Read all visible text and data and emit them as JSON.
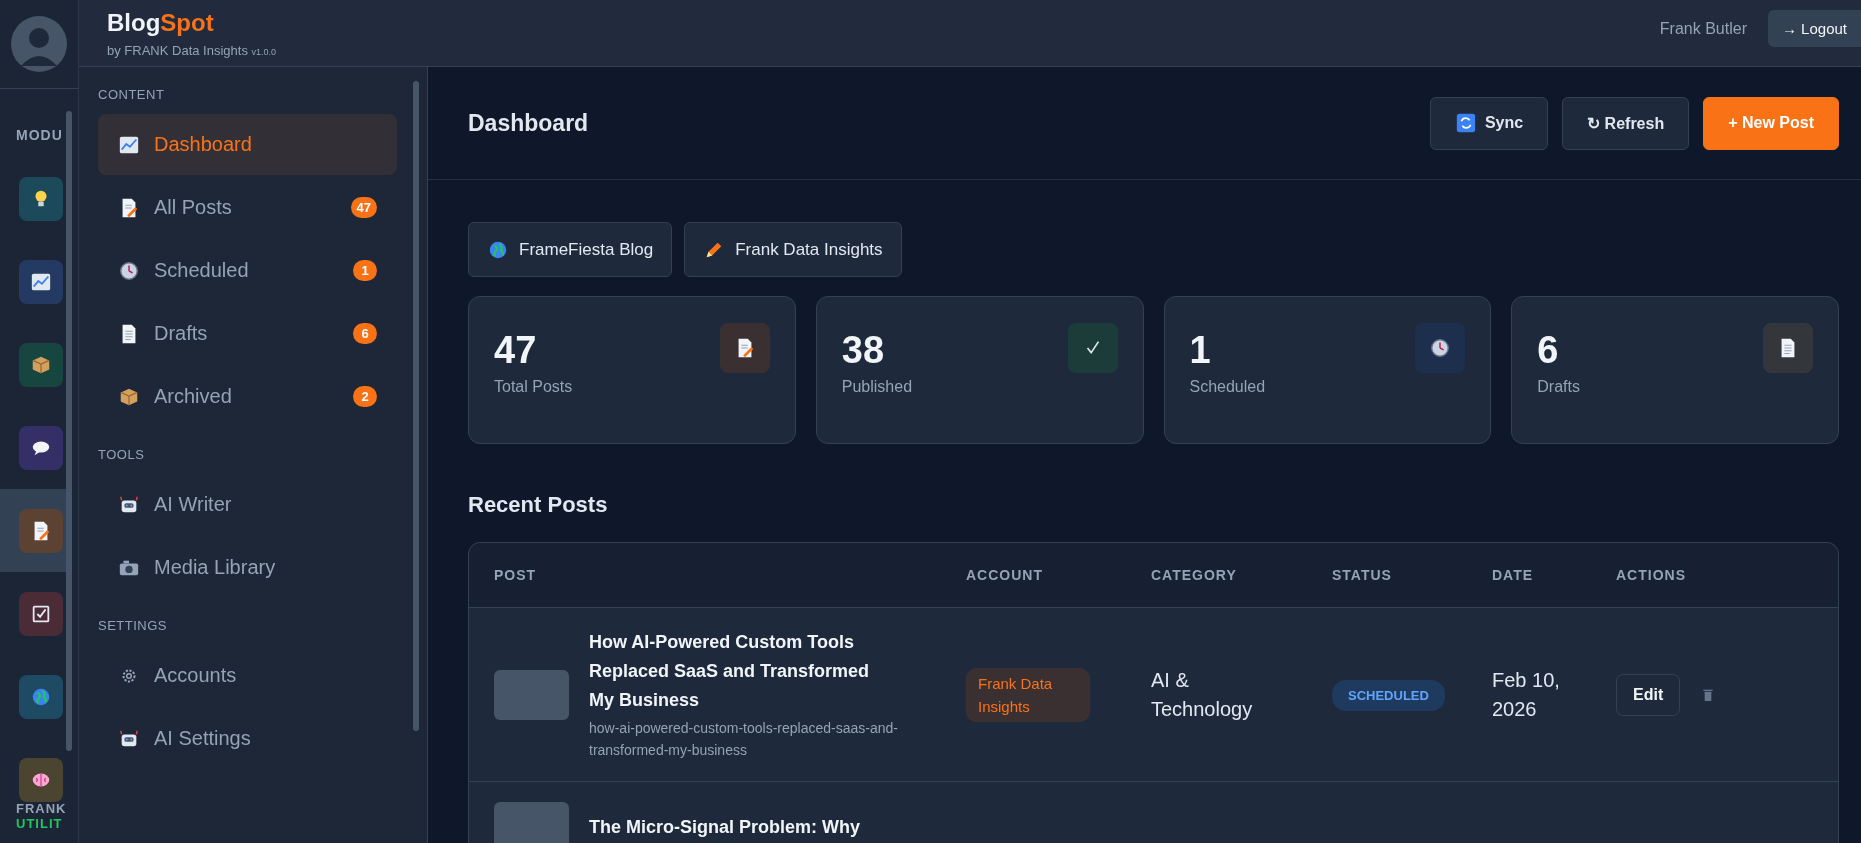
{
  "rail": {
    "heading": "MODU",
    "items": [
      {
        "selected": false
      },
      {
        "selected": false
      },
      {
        "selected": false
      },
      {
        "selected": false
      },
      {
        "selected": true
      },
      {
        "selected": false
      },
      {
        "selected": false
      },
      {
        "selected": false
      }
    ],
    "footer": [
      "FRANK",
      "UTILIT"
    ]
  },
  "header": {
    "brand": [
      "Blog",
      "Spot"
    ],
    "subtitle": "by FRANK Data Insights",
    "version": "v1.0.0",
    "user": "Frank Butler",
    "logout": "→ Logout"
  },
  "sidebar": {
    "sections": [
      {
        "title": "CONTENT",
        "items": [
          {
            "label": "Dashboard",
            "selected": true
          },
          {
            "label": "All Posts",
            "badge": "47",
            "selected": false
          },
          {
            "label": "Scheduled",
            "badge": "1",
            "selected": false
          },
          {
            "label": "Drafts",
            "badge": "6",
            "selected": false
          },
          {
            "label": "Archived",
            "badge": "2",
            "selected": false
          }
        ]
      },
      {
        "title": "TOOLS",
        "items": [
          {
            "label": "AI Writer",
            "selected": false
          },
          {
            "label": "Media Library",
            "selected": false
          }
        ]
      },
      {
        "title": "SETTINGS",
        "items": [
          {
            "label": "Accounts",
            "selected": false
          },
          {
            "label": "AI Settings",
            "selected": false
          }
        ]
      }
    ]
  },
  "page": {
    "title": "Dashboard",
    "buttons": [
      {
        "kind": "sync",
        "label": "Sync"
      },
      {
        "kind": "plain",
        "label": "↻ Refresh"
      },
      {
        "kind": "primary",
        "label": "+ New Post"
      }
    ]
  },
  "accounts": [
    {
      "label": "FrameFiesta Blog"
    },
    {
      "label": "Frank Data Insights"
    }
  ],
  "stats": [
    {
      "value": "47",
      "label": "Total Posts"
    },
    {
      "value": "38",
      "label": "Published"
    },
    {
      "value": "1",
      "label": "Scheduled"
    },
    {
      "value": "6",
      "label": "Drafts"
    }
  ],
  "recent_posts": {
    "title": "Recent Posts",
    "columns": [
      "POST",
      "ACCOUNT",
      "CATEGORY",
      "STATUS",
      "DATE",
      "ACTIONS"
    ],
    "rows": [
      {
        "title": "How AI-Powered Custom Tools Replaced SaaS and Transformed My Business",
        "slug": "how-ai-powered-custom-tools-replaced-saas-and-transformed-my-business",
        "account": "Frank Data Insights",
        "category": "AI & Technology",
        "status": "SCHEDULED",
        "date": "Feb 10, 2026",
        "edit": "Edit"
      },
      {
        "title": "The Micro-Signal Problem: Why"
      }
    ]
  }
}
